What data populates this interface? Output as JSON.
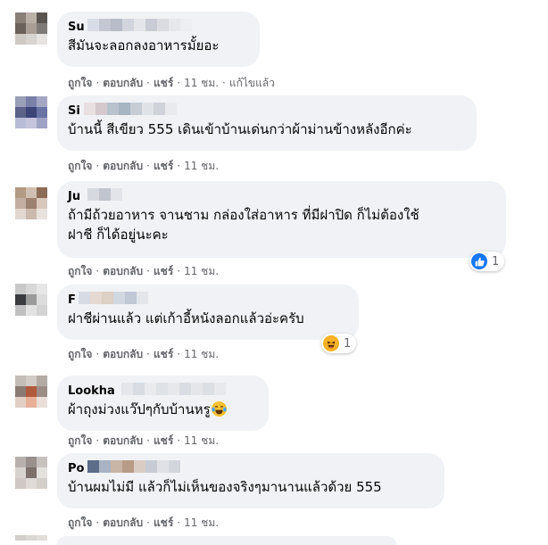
{
  "comments": [
    {
      "author": "Su",
      "text": "สีมันจะลอกลงอาหารมั้ยอะ",
      "actions": {
        "like": "ถูกใจ",
        "reply": "ตอบกลับ",
        "share": "แชร์",
        "time": "11 ชม.",
        "edited": "แก้ไขแล้ว"
      }
    },
    {
      "author": "Si",
      "text": "บ้านนี้ สีเขียว 555 เดินเข้าบ้านเด่นกว่าผ้าม่านข้างหลังอีกค่ะ",
      "actions": {
        "like": "ถูกใจ",
        "reply": "ตอบกลับ",
        "share": "แชร์",
        "time": "11 ชม."
      }
    },
    {
      "author": "Ju",
      "text": "ถ้ามีถ้วยอาหาร จานชาม กล่องใส่อาหาร ที่มีฝาปิด ก็ไม่ต้องใช้\nฝาชี ก็ได้อยู่นะคะ",
      "actions": {
        "like": "ถูกใจ",
        "reply": "ตอบกลับ",
        "share": "แชร์",
        "time": "11 ชม."
      },
      "reaction": {
        "type": "like-icon",
        "count": "1"
      }
    },
    {
      "author": "F",
      "text": "ฝาชีผ่านแล้ว แต่เก้าอี้หนังลอกแล้วอ่ะครับ",
      "actions": {
        "like": "ถูกใจ",
        "reply": "ตอบกลับ",
        "share": "แชร์",
        "time": "11 ชม."
      },
      "reaction": {
        "type": "haha-icon",
        "count": "1"
      }
    },
    {
      "author": "Lookha",
      "text": "ผ้าถุงม่วงแว๊ปๆกับบ้านหรู",
      "emoji": "laughing-tears-emoji",
      "actions": {
        "like": "ถูกใจ",
        "reply": "ตอบกลับ",
        "share": "แชร์",
        "time": "11 ชม."
      }
    },
    {
      "author": "Po",
      "text": "บ้านผมไม่มี แล้วก็ไม่เห็นของจริงๆมานานแล้วด้วย 555",
      "actions": {
        "like": "ถูกใจ",
        "reply": "ตอบกลับ",
        "share": "แชร์",
        "time": "11 ชม."
      }
    }
  ],
  "colors": {
    "bubble": "#f0f2f5",
    "meta_text": "#65676b",
    "like_blue": "#1877f2",
    "haha_yellow": "#f7b125"
  }
}
